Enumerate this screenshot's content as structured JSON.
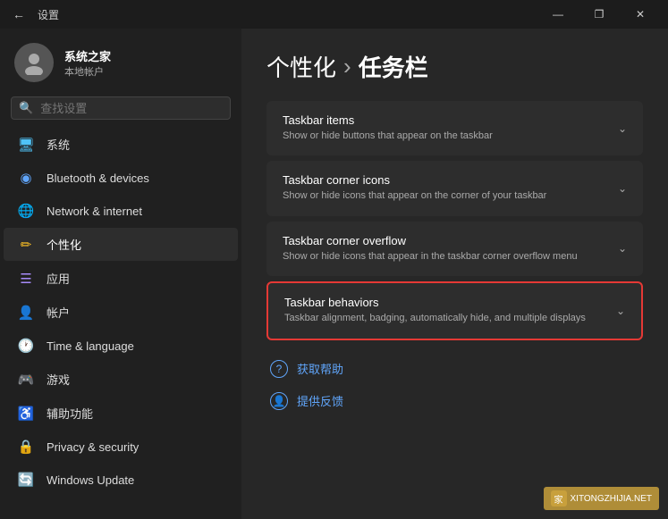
{
  "titleBar": {
    "title": "设置",
    "minimizeLabel": "—",
    "maximizeLabel": "❐",
    "closeLabel": "✕"
  },
  "user": {
    "name": "系统之家",
    "accountType": "本地帐户"
  },
  "search": {
    "placeholder": "查找设置"
  },
  "navItems": [
    {
      "id": "system",
      "label": "系统",
      "icon": "🖥",
      "iconClass": "icon-system",
      "active": false
    },
    {
      "id": "bluetooth",
      "label": "Bluetooth & devices",
      "icon": "◉",
      "iconClass": "icon-bluetooth",
      "active": false
    },
    {
      "id": "network",
      "label": "Network & internet",
      "icon": "🌐",
      "iconClass": "icon-network",
      "active": false
    },
    {
      "id": "personalization",
      "label": "个性化",
      "icon": "✏",
      "iconClass": "icon-personal",
      "active": true
    },
    {
      "id": "apps",
      "label": "应用",
      "icon": "☰",
      "iconClass": "icon-apps",
      "active": false
    },
    {
      "id": "accounts",
      "label": "帐户",
      "icon": "👤",
      "iconClass": "icon-accounts",
      "active": false
    },
    {
      "id": "time",
      "label": "Time & language",
      "icon": "🕐",
      "iconClass": "icon-time",
      "active": false
    },
    {
      "id": "gaming",
      "label": "游戏",
      "icon": "🎮",
      "iconClass": "icon-gaming",
      "active": false
    },
    {
      "id": "accessibility",
      "label": "辅助功能",
      "icon": "♿",
      "iconClass": "icon-access",
      "active": false
    },
    {
      "id": "privacy",
      "label": "Privacy & security",
      "icon": "🔒",
      "iconClass": "icon-privacy",
      "active": false
    },
    {
      "id": "update",
      "label": "Windows Update",
      "icon": "🔄",
      "iconClass": "icon-update",
      "active": false
    }
  ],
  "main": {
    "breadcrumbParent": "个性化",
    "breadcrumbSeparator": "›",
    "breadcrumbCurrent": "任务栏",
    "cards": [
      {
        "id": "taskbar-items",
        "title": "Taskbar items",
        "desc": "Show or hide buttons that appear on the taskbar",
        "highlighted": false
      },
      {
        "id": "taskbar-corner-icons",
        "title": "Taskbar corner icons",
        "desc": "Show or hide icons that appear on the corner of your taskbar",
        "highlighted": false
      },
      {
        "id": "taskbar-corner-overflow",
        "title": "Taskbar corner overflow",
        "desc": "Show or hide icons that appear in the taskbar corner overflow menu",
        "highlighted": false
      },
      {
        "id": "taskbar-behaviors",
        "title": "Taskbar behaviors",
        "desc": "Taskbar alignment, badging, automatically hide, and multiple displays",
        "highlighted": true
      }
    ],
    "helpLinks": [
      {
        "id": "get-help",
        "label": "获取帮助",
        "icon": "?"
      },
      {
        "id": "feedback",
        "label": "提供反馈",
        "icon": "👤"
      }
    ]
  },
  "watermark": {
    "text": "XITONGZHIJIA.NET",
    "icon": "家"
  }
}
